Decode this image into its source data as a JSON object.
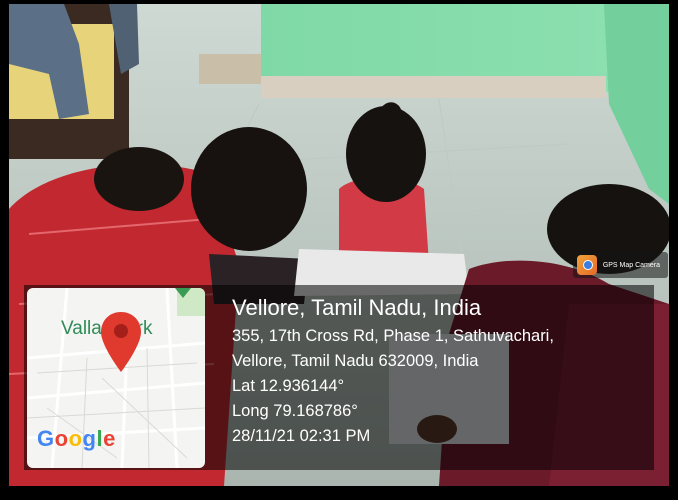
{
  "location": {
    "title": "Vellore, Tamil Nadu, India",
    "address_line1": "355, 17th Cross Rd, Phase 1, Sathuvachari,",
    "address_line2": "Vellore, Tamil Nadu 632009, India",
    "latitude": "Lat 12.936144°",
    "longitude": "Long 79.168786°",
    "timestamp": "28/11/21 02:31 PM"
  },
  "map": {
    "place_label": "Vallar Park",
    "brand": "Google",
    "pin_color": "#e03a2f"
  },
  "watermark": {
    "app_name": "GPS Map Camera",
    "icon": "gps-map-camera-icon"
  }
}
